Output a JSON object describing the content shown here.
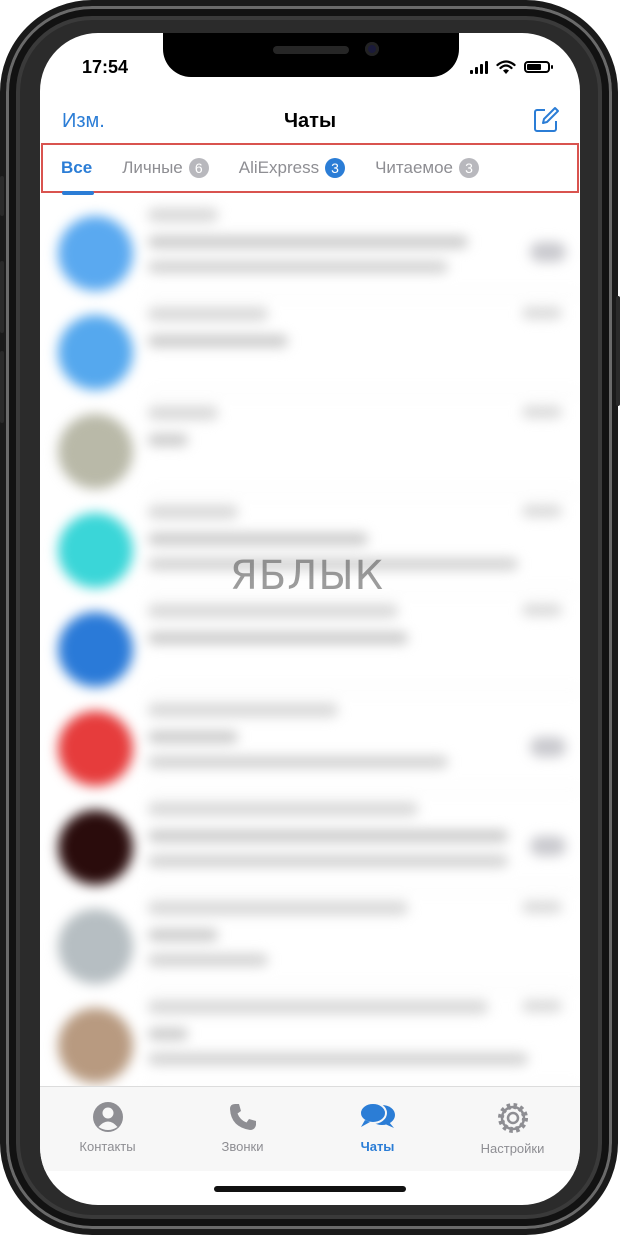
{
  "status": {
    "time": "17:54",
    "battery_level": 0.8
  },
  "nav": {
    "edit_label": "Изм.",
    "title": "Чаты",
    "compose_icon": "compose-icon"
  },
  "tabs": [
    {
      "label": "Все",
      "active": true
    },
    {
      "label": "Личные",
      "count": "6"
    },
    {
      "label": "AliExpress",
      "count": "3",
      "highlight": true
    },
    {
      "label": "Читаемое",
      "count": "3"
    }
  ],
  "watermark": "ЯБЛЫК",
  "tabbar": {
    "items": [
      {
        "label": "Контакты",
        "icon": "person-icon"
      },
      {
        "label": "Звонки",
        "icon": "phone-icon"
      },
      {
        "label": "Чаты",
        "icon": "chat-bubbles-icon",
        "active": true
      },
      {
        "label": "Настройки",
        "icon": "gear-icon"
      }
    ]
  },
  "colors": {
    "accent": "#2b7dd6",
    "highlight_box": "#d9534f"
  }
}
